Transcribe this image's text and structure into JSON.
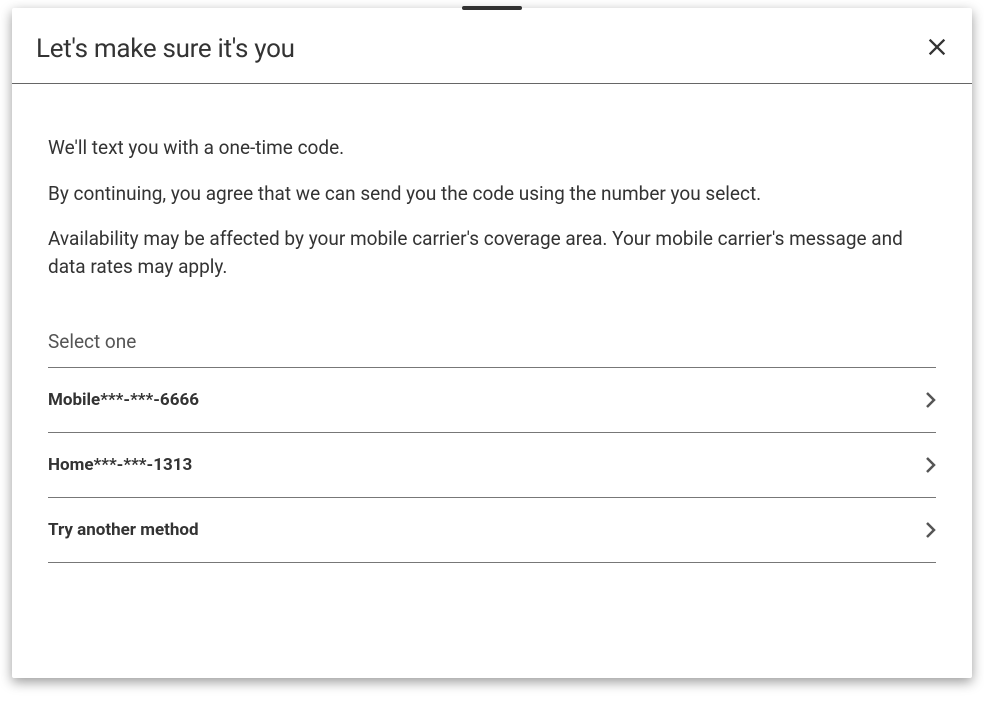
{
  "modal": {
    "title": "Let's make sure it's you",
    "info_line1": "We'll text you with a one-time code.",
    "info_line2": "By continuing, you agree that we can send you the code using the number you select.",
    "info_line3": "Availability may be affected by your mobile carrier's coverage area. Your mobile carrier's message and data rates may apply.",
    "select_label": "Select one",
    "options": [
      {
        "label": "Mobile***-***-6666"
      },
      {
        "label": "Home***-***-1313"
      },
      {
        "label": "Try another method"
      }
    ]
  }
}
